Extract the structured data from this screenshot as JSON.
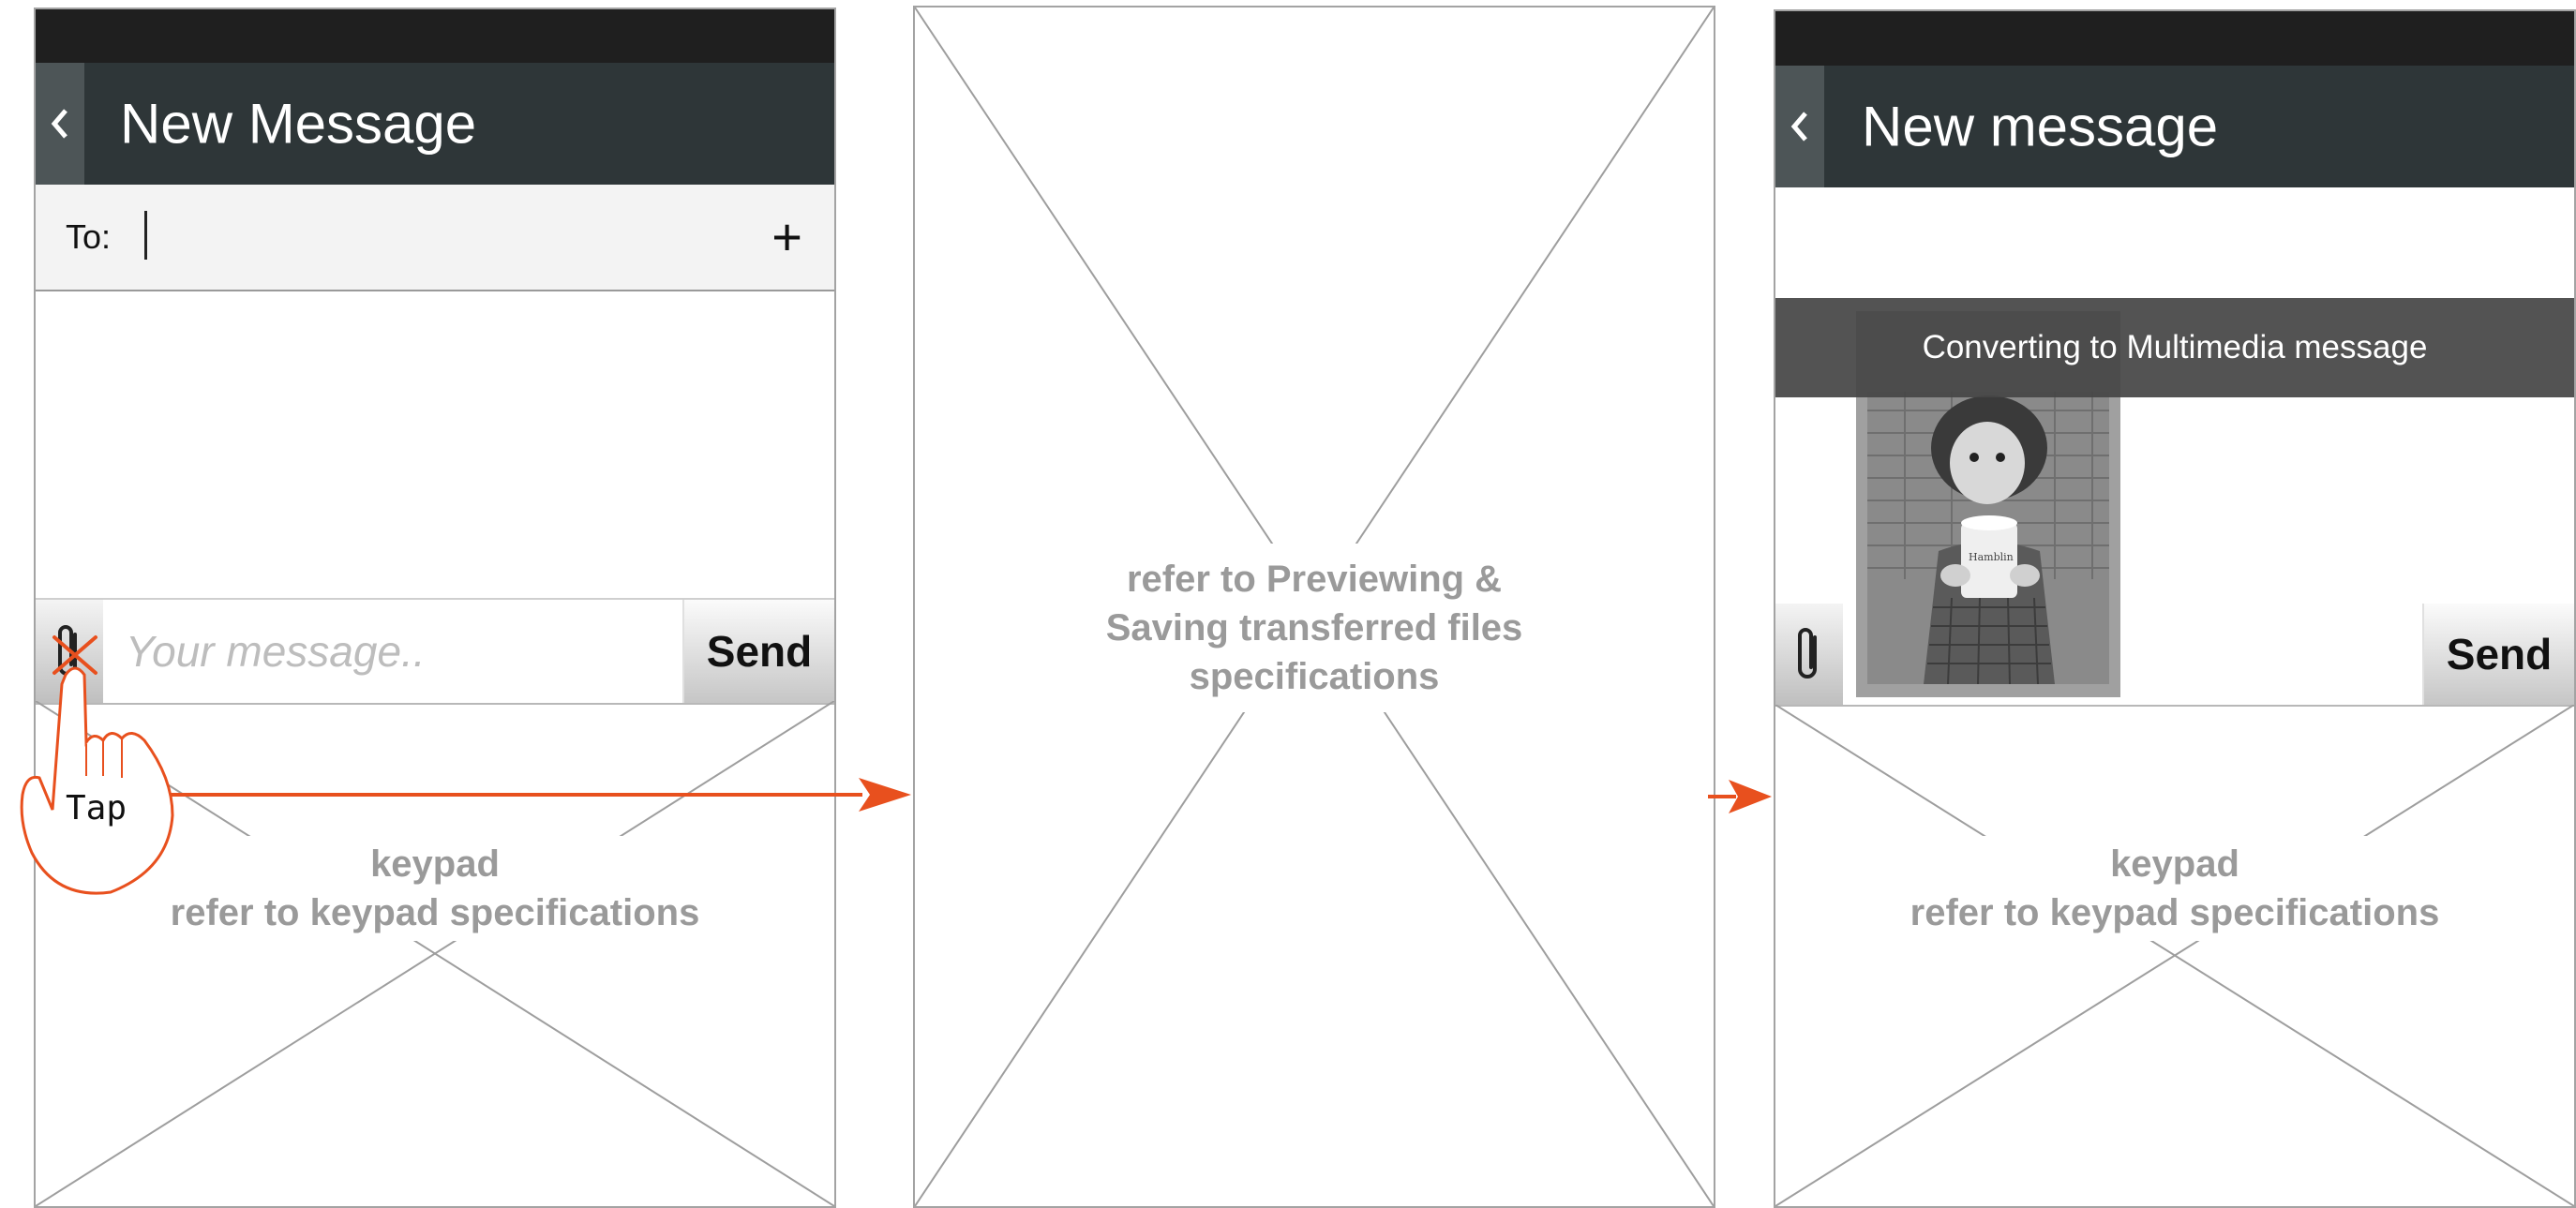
{
  "colors": {
    "accent": "#e8501e",
    "status_bar": "#1f1f1f",
    "title_bar": "#2e3638",
    "back_button": "#4d5557",
    "placeholder_text": "#9a9a9a"
  },
  "screen1": {
    "title": "New Message",
    "back_icon": "chevron-left-icon",
    "to_label": "To:",
    "add_icon": "+",
    "message_placeholder": "Your message..",
    "send_label": "Send",
    "attach_icon": "paperclip-icon",
    "keypad_title": "keypad",
    "keypad_ref": "refer to keypad specifications"
  },
  "gesture": {
    "label": "Tap",
    "icon": "hand-tap-icon"
  },
  "screen2": {
    "line1": "refer to Previewing &",
    "line2": "Saving transferred files",
    "line3": "specifications"
  },
  "screen3": {
    "title": "New message",
    "back_icon": "chevron-left-icon",
    "banner_text": "Converting to Multimedia message",
    "send_label": "Send",
    "attach_icon": "paperclip-icon",
    "attachment_image": "photo-of-child-drinking-from-cup",
    "keypad_title": "keypad",
    "keypad_ref": "refer to keypad specifications"
  }
}
